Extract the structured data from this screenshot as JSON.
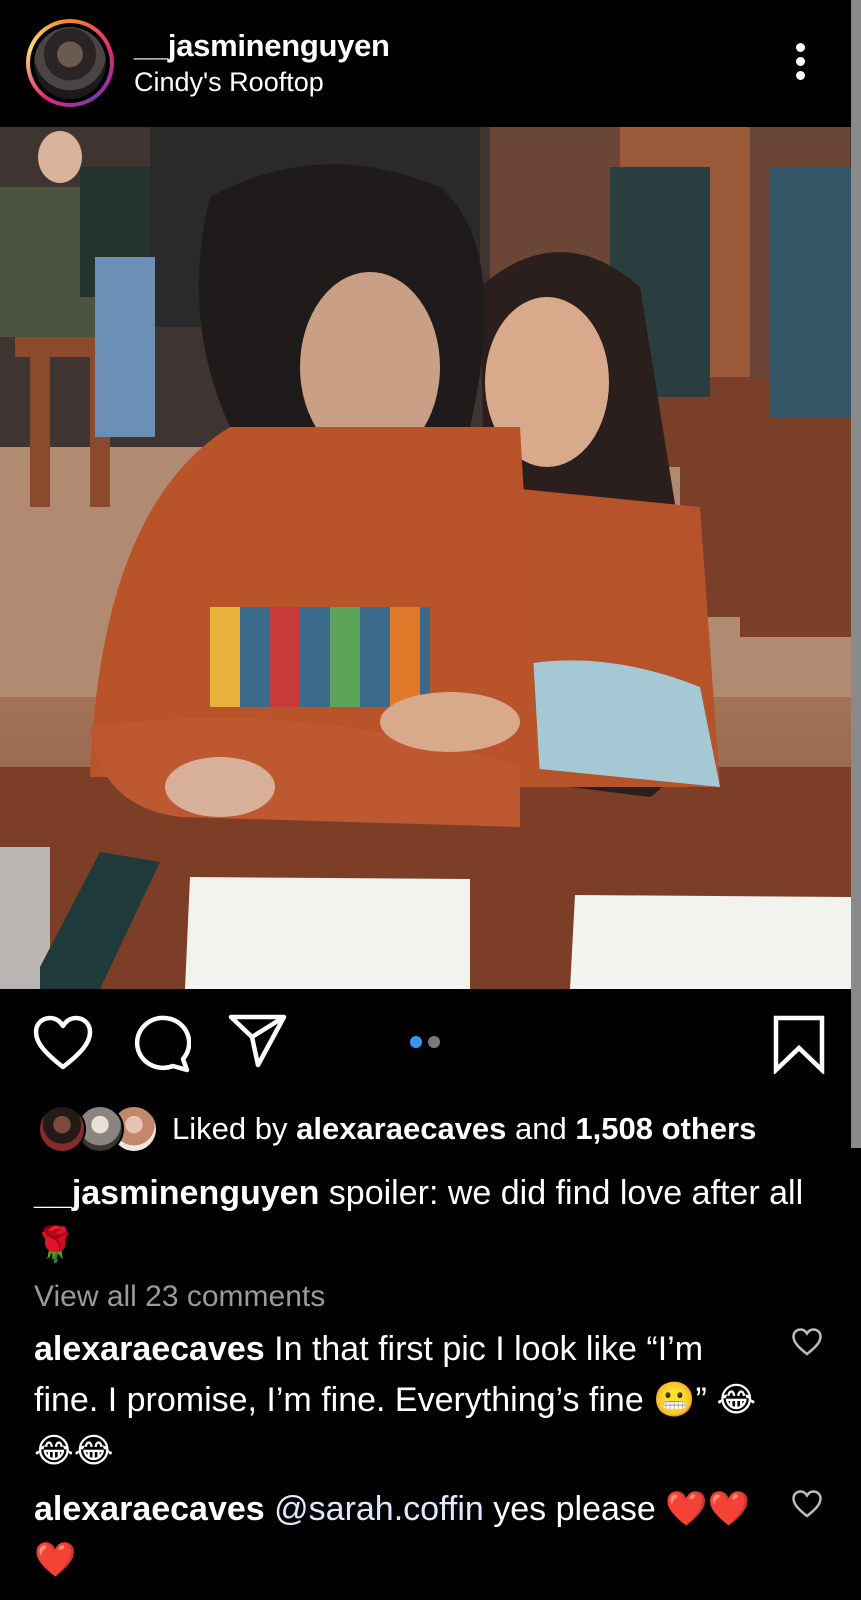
{
  "post": {
    "username": "__jasminenguyen",
    "location": "Cindy's Rooftop",
    "carousel": {
      "total": 2,
      "active": 1
    }
  },
  "likes": {
    "prefix": "Liked by",
    "user": "alexaraecaves",
    "middle": "and",
    "others": "1,508 others"
  },
  "caption": {
    "username": "__jasminenguyen",
    "text": "spoiler: we did find love after all",
    "emoji": "🌹"
  },
  "view_all": "View all 23 comments",
  "comments": [
    {
      "username": "alexaraecaves",
      "text": "In that first pic I look like “I’m fine. I promise, I’m fine. Everything’s fine",
      "emoji": "😬",
      "tail": "”",
      "emoji2": "😂😂😂"
    },
    {
      "username": "alexaraecaves",
      "mention": "@sarah.coffin",
      "text": "yes please",
      "emoji": "❤️❤️❤️"
    }
  ],
  "colors": {
    "accent_blue": "#3897f0",
    "mention": "#e0e8ff",
    "muted": "#9a9a9a"
  },
  "icons": [
    "more-vertical-icon",
    "heart-icon",
    "comment-icon",
    "share-icon",
    "bookmark-icon",
    "comment-heart-icon"
  ]
}
